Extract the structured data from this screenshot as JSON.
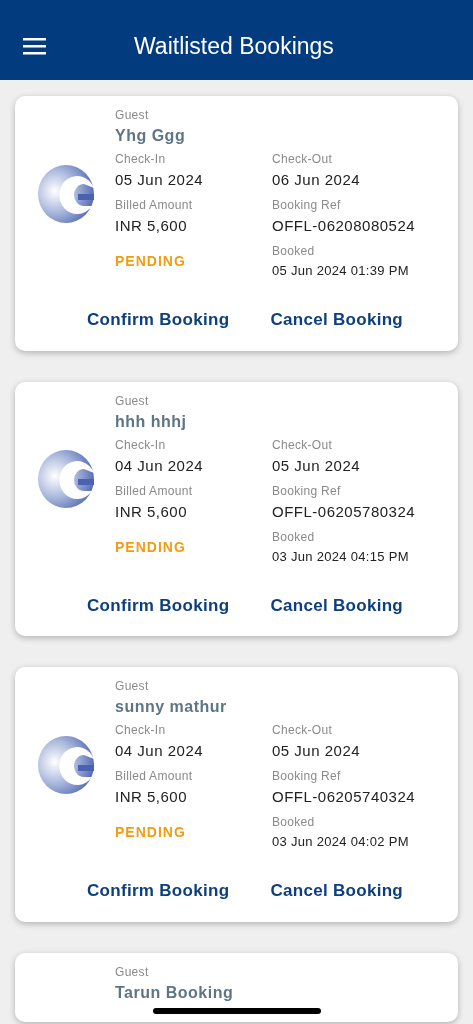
{
  "header": {
    "title": "Waitlisted Bookings"
  },
  "bookings": [
    {
      "guest_label": "Guest",
      "guest": "Yhg Ggg",
      "check_in_label": "Check-In",
      "check_in": "05 Jun 2024",
      "check_out_label": "Check-Out",
      "check_out": "06 Jun 2024",
      "amount_label": "Billed Amount",
      "amount": "INR 5,600",
      "ref_label": "Booking Ref",
      "ref": "OFFL-06208080524",
      "status": "PENDING",
      "booked_label": "Booked",
      "booked": "05 Jun 2024 01:39 PM",
      "actions": [
        "Confirm Booking",
        "Cancel Booking"
      ]
    },
    {
      "guest_label": "Guest",
      "guest": "hhh hhhj",
      "check_in_label": "Check-In",
      "check_in": "04 Jun 2024",
      "check_out_label": "Check-Out",
      "check_out": "05 Jun 2024",
      "amount_label": "Billed Amount",
      "amount": "INR 5,600",
      "ref_label": "Booking Ref",
      "ref": "OFFL-06205780324",
      "status": "PENDING",
      "booked_label": "Booked",
      "booked": "03 Jun 2024 04:15 PM",
      "actions": [
        "Confirm Booking",
        "Cancel Booking"
      ]
    },
    {
      "guest_label": "Guest",
      "guest": "sunny mathur",
      "check_in_label": "Check-In",
      "check_in": "04 Jun 2024",
      "check_out_label": "Check-Out",
      "check_out": "05 Jun 2024",
      "amount_label": "Billed Amount",
      "amount": "INR 5,600",
      "ref_label": "Booking Ref",
      "ref": "OFFL-06205740324",
      "status": "PENDING",
      "booked_label": "Booked",
      "booked": "03 Jun 2024 04:02 PM",
      "actions": [
        "Confirm Booking",
        "Cancel Booking"
      ]
    },
    {
      "guest_label": "Guest",
      "guest": "Tarun Booking"
    }
  ]
}
